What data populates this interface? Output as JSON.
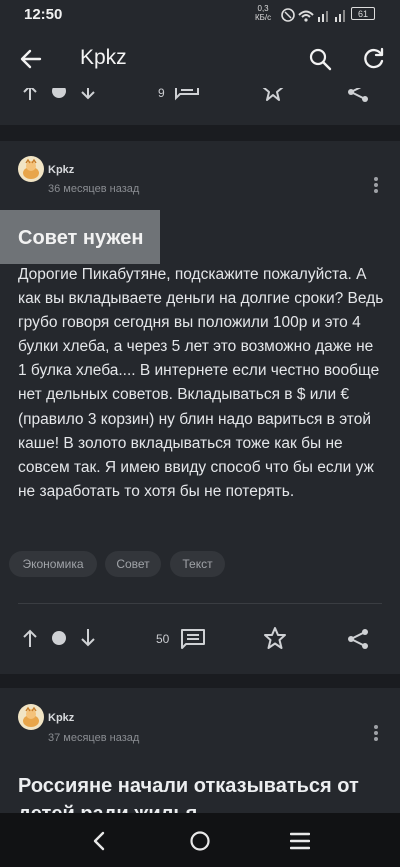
{
  "status": {
    "time": "12:50",
    "net_speed": "0,3",
    "net_unit": "КБ/с",
    "battery": "61"
  },
  "appbar": {
    "title": "Kpkz"
  },
  "prev_post": {
    "comments": "9"
  },
  "post1": {
    "author": "Kpkz",
    "time": "36 месяцев назад",
    "title": "Совет нужен",
    "body": "Дорогие Пикабутяне, подскажите пожалуйста. А как вы вкладываете деньги на долгие сроки? Ведь грубо говоря сегодня вы положили 100р и это 4 булки хлеба, а через 5 лет это возможно даже не 1 булка хлеба.... В интернете если честно вообще нет дельных советов. Вкладываться в $ или € (правило 3 корзин) ну блин надо вариться в этой каше! В золото вкладываться тоже как бы не совсем так. Я имею ввиду способ что бы если уж не заработать то хотя бы не потерять.",
    "tags": [
      "Экономика",
      "Совет",
      "Текст"
    ],
    "comments": "50"
  },
  "post2": {
    "author": "Kpkz",
    "time": "37 месяцев назад",
    "title": "Россияне начали отказываться от детей ради жилья"
  },
  "colors": {
    "card": "#25282d",
    "background": "#1a1c20",
    "accent_gray": "#6f7377"
  }
}
